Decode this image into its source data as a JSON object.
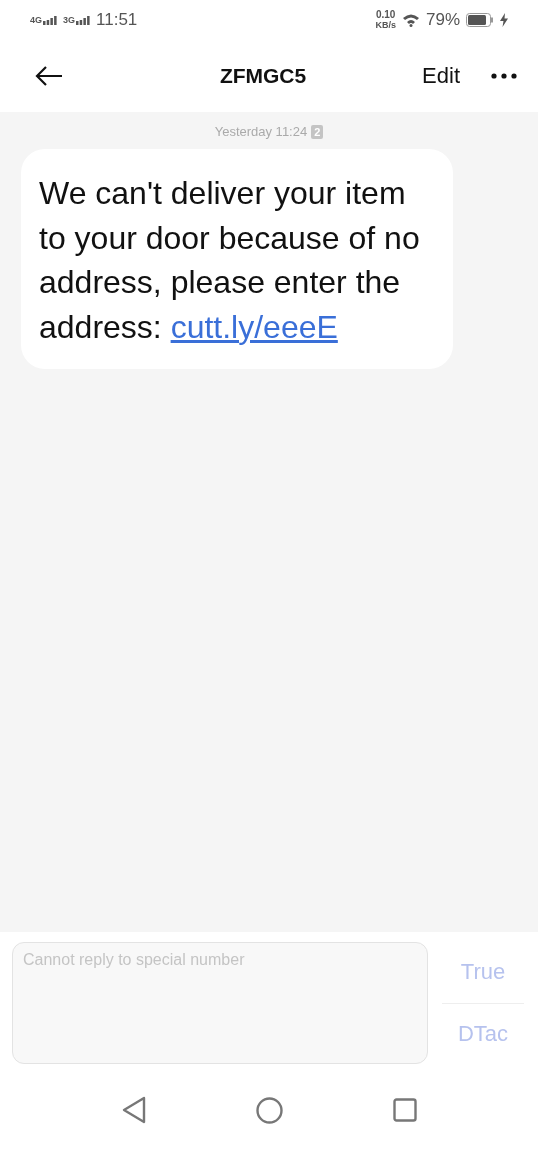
{
  "status_bar": {
    "networks": [
      "4G",
      "3G"
    ],
    "time": "11:51",
    "speed_value": "0.10",
    "speed_unit": "KB/s",
    "battery": "79%"
  },
  "header": {
    "title": "ZFMGC5",
    "edit": "Edit"
  },
  "messages": [
    {
      "timestamp": "Yesterday 11:24",
      "sim": "2",
      "text": "We can't deliver your item to your door because of no address, please enter the address: ",
      "link": "cutt.ly/eeeE"
    }
  ],
  "composer": {
    "placeholder": "Cannot reply to special number",
    "disabled": true
  },
  "sim_buttons": [
    {
      "label": "True",
      "disabled": true
    },
    {
      "label": "DTac",
      "disabled": true
    }
  ]
}
